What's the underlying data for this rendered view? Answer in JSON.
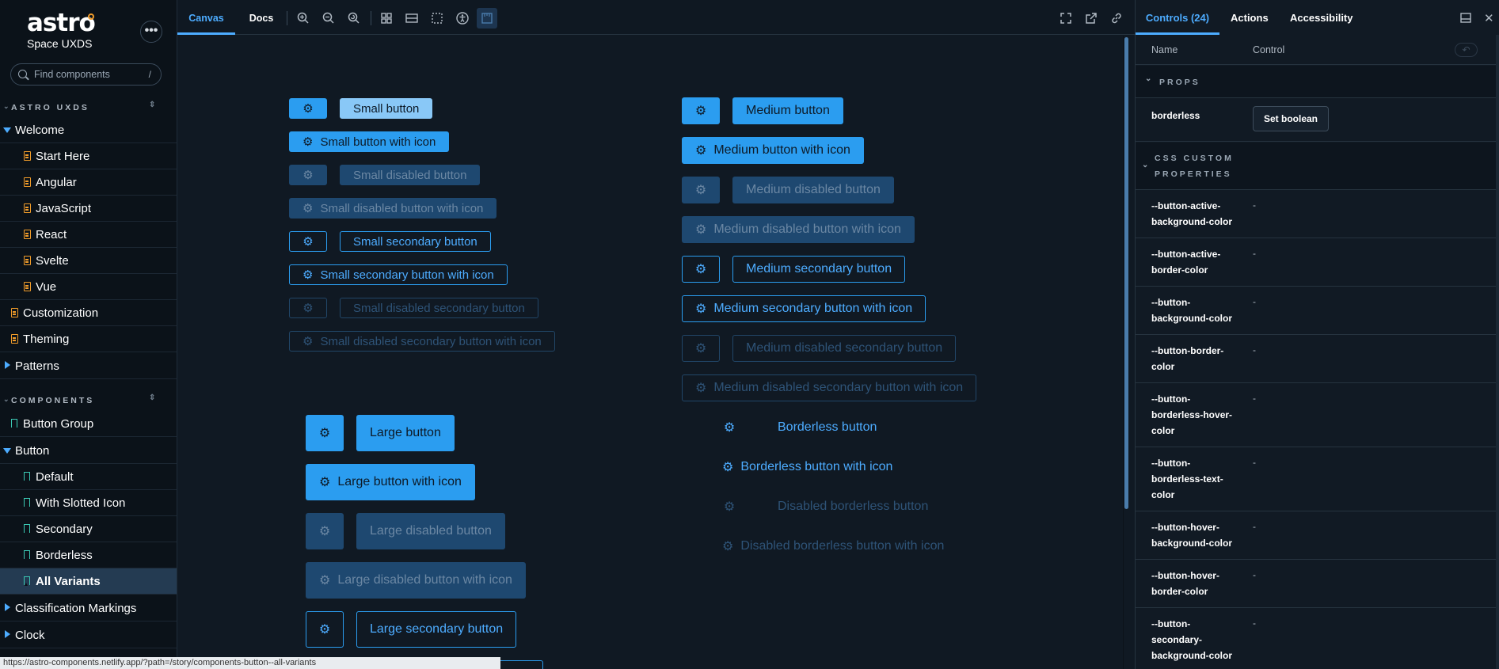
{
  "sidebar": {
    "brand": "astro",
    "subtitle": "Space UXDS",
    "menu_glyph": "•••",
    "search_placeholder": "Find components",
    "search_shortcut": "/",
    "section_astro": "ASTRO UXDS",
    "section_components": "COMPONENTS",
    "items": [
      {
        "label": "Welcome"
      },
      {
        "label": "Start Here"
      },
      {
        "label": "Angular"
      },
      {
        "label": "JavaScript"
      },
      {
        "label": "React"
      },
      {
        "label": "Svelte"
      },
      {
        "label": "Vue"
      },
      {
        "label": "Customization"
      },
      {
        "label": "Theming"
      },
      {
        "label": "Patterns"
      },
      {
        "label": "Button Group"
      },
      {
        "label": "Button"
      },
      {
        "label": "Default"
      },
      {
        "label": "With Slotted Icon"
      },
      {
        "label": "Secondary"
      },
      {
        "label": "Borderless"
      },
      {
        "label": "All Variants"
      },
      {
        "label": "Classification Markings"
      },
      {
        "label": "Clock"
      }
    ],
    "status_url": "https://astro-components.netlify.app/?path=/story/components-button--all-variants"
  },
  "toolbar": {
    "tab_canvas": "Canvas",
    "tab_docs": "Docs",
    "icons": [
      "zoom-in-icon",
      "zoom-out-icon",
      "zoom-reset-icon",
      "grid-icon",
      "background-icon",
      "outline-icon",
      "accessibility-icon",
      "measure-icon",
      "fullscreen-icon",
      "open-new-tab-icon",
      "copy-link-icon"
    ]
  },
  "canvas": {
    "small": [
      "Small button",
      "Small button with icon",
      "Small disabled button",
      "Small disabled button with icon",
      "Small secondary button",
      "Small secondary button with icon",
      "Small disabled secondary button",
      "Small disabled secondary button with icon"
    ],
    "medium": [
      "Medium button",
      "Medium button with icon",
      "Medium disabled button",
      "Medium disabled button with icon",
      "Medium secondary button",
      "Medium secondary button with icon",
      "Medium disabled secondary button",
      "Medium disabled secondary button with icon"
    ],
    "borderless": [
      "Borderless button",
      "Borderless button with icon",
      "Disabled borderless button",
      "Disabled borderless button with icon"
    ],
    "large": [
      "Large button",
      "Large button with icon",
      "Large disabled button",
      "Large disabled button with icon",
      "Large secondary button"
    ]
  },
  "panel": {
    "tab_controls": "Controls (24)",
    "tab_actions": "Actions",
    "tab_accessibility": "Accessibility",
    "col_name": "Name",
    "col_control": "Control",
    "group_props": "PROPS",
    "group_css": "CSS CUSTOM PROPERTIES",
    "borderless_name": "borderless",
    "set_boolean": "Set boolean",
    "rows": [
      {
        "name": "--button-active-background-color",
        "value": "-"
      },
      {
        "name": "--button-active-border-color",
        "value": "-"
      },
      {
        "name": "--button-background-color",
        "value": "-"
      },
      {
        "name": "--button-border-color",
        "value": "-"
      },
      {
        "name": "--button-borderless-hover-color",
        "value": "-"
      },
      {
        "name": "--button-borderless-text-color",
        "value": "-"
      },
      {
        "name": "--button-hover-background-color",
        "value": "-"
      },
      {
        "name": "--button-hover-border-color",
        "value": "-"
      },
      {
        "name": "--button-secondary-background-color",
        "value": "-"
      }
    ]
  },
  "colors": {
    "accent": "#4dacff",
    "primary_button": "#2b9df0",
    "disabled_button": "#1e4870",
    "doc_icon": "#f19c2a",
    "story_icon": "#3bc9b4",
    "background": "#101923"
  }
}
